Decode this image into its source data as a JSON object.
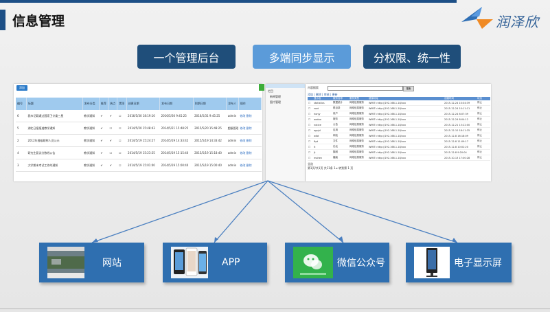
{
  "header": {
    "title": "信息管理",
    "logo_text": "润泽欣"
  },
  "pills": [
    "一个管理后台",
    "多端同步显示",
    "分权限、统一性"
  ],
  "admin_screen": {
    "add_label": "添加",
    "columns": [
      "编号",
      "标题",
      "发布分类",
      "推荐",
      "热点",
      "置顶",
      "创建日期",
      "发布日期",
      "到期日期",
      "发布人",
      "操作"
    ],
    "rows": [
      [
        "6",
        "我市记载通过国家卫计委三星",
        "教学通知",
        "✔",
        "✔",
        "☐",
        "2016/5/30 18:19:10",
        "2016/5/30 9:45:25",
        "2016/5/31 9:45:25",
        "admin",
        "修改 删除"
      ],
      [
        "5",
        "湖北日报报道教学通知",
        "教学通知",
        "✔",
        "☐",
        "☐",
        "2014/5/20 15:48:43",
        "2014/5/21 15:48:25",
        "2015/5/20 15:48:25",
        "超级管理员",
        "修改 删除"
      ],
      [
        "2",
        "2012年晋级职称人员公示",
        "教学通知",
        "✔",
        "✔",
        "☐",
        "2014/5/19 15:24:27",
        "2014/5/19 14:33:42",
        "2015/5/19 14:33:42",
        "admin",
        "修改 删除"
      ],
      [
        "4",
        "研究生复试分数线公告",
        "教学通知",
        "✔",
        "☐",
        "☐",
        "2014/5/19 15:23:25",
        "2014/5/19 15:15:40",
        "2015/5/19 15:18:40",
        "admin",
        "修改 删除"
      ],
      [
        "3",
        "大学期末考试工作的通知",
        "教学通知",
        "✔",
        "✔",
        "☐",
        "2014/5/19 15:01:00",
        "2014/5/19 15:00:40",
        "2015/5/19 15:00:40",
        "admin",
        "修改 删除"
      ]
    ]
  },
  "side_menu": {
    "items": [
      "栏目",
      "新闻管理",
      "图片管理"
    ]
  },
  "list_screen": {
    "search_label": "内容搜索",
    "search_button": "搜索",
    "links": "添加 | 删除 | 审核 | 更新",
    "columns": [
      "",
      "显示名",
      "服务名称",
      "服务类型",
      "链接地址",
      "创建时间",
      "状态"
    ],
    "rows": [
      [
        "☐",
        "statistics",
        "数据统计",
        "网络信息服务",
        "WMIT=http://192.168.1.18/xxx",
        "2015-12-24 10:04:39",
        "停止"
      ],
      [
        "☐",
        "root",
        "根目录",
        "网络信息服务",
        "WMIT=http://192.168.1.18/xxx",
        "2015-12-24 10:11:11",
        "停止"
      ],
      [
        "☐",
        "honjy",
        "用户",
        "网络信息服务",
        "WMIT=http://192.168.1.18/xxx",
        "2015-12-24 8:07:39",
        "停止"
      ],
      [
        "☐",
        "oodoo",
        "服务",
        "网络信息服务",
        "WMIT=http://192.168.1.18/xxx",
        "2015-12-24 8:04:12",
        "停止"
      ],
      [
        "☐",
        "notice",
        "公告",
        "网络信息服务",
        "WMIT=http://192.168.1.18/xxx",
        "2015-12-21 13:22:00",
        "停止"
      ],
      [
        "☐",
        "appjd",
        "应用",
        "网络信息服务",
        "WMIT=http://192.168.1.18/xxx",
        "2015-12-10 18:11:35",
        "停止"
      ],
      [
        "☐",
        "wlbt",
        "网站",
        "网络信息服务",
        "WMIT=http://192.168.1.18/xxx",
        "2015-12-8 16:18:09",
        "停止"
      ],
      [
        "☐",
        "ftpt",
        "文件",
        "网络信息服务",
        "WMIT=http://192.168.1.18/xxx",
        "2015-12-8 11:09:17",
        "停止"
      ],
      [
        "☐",
        "lt",
        "论坛",
        "网络信息服务",
        "WMIT=http://192.168.1.18/xxx",
        "2015-12-8 10:02:20",
        "停止"
      ],
      [
        "☐",
        "jt",
        "集团",
        "网络信息服务",
        "WMIT=http://192.168.1.18/xxx",
        "2015-12-8 9:20:04",
        "停止"
      ],
      [
        "☐",
        "mohen",
        "磨痕",
        "网络信息服务",
        "WMIT=http://192.168.1.18/xxx",
        "2015-10-13 17:00:28",
        "停止"
      ]
    ],
    "select_all": "全选",
    "pager": "第1页/共1页 共11条 1 ▸ 转到第 1 页"
  },
  "targets": [
    {
      "label": "网站",
      "icon": "website-thumbnail-icon"
    },
    {
      "label": "APP",
      "icon": "phone-app-icon"
    },
    {
      "label": "微信公众号",
      "icon": "wechat-icon"
    },
    {
      "label": "电子显示屏",
      "icon": "display-kiosk-icon"
    }
  ],
  "colors": {
    "navy": "#1d4f86",
    "pill_dark": "#1f4e7a",
    "pill_light": "#5b9bd9",
    "target_box": "#2f6fb0",
    "wechat_green": "#2fb34a"
  }
}
